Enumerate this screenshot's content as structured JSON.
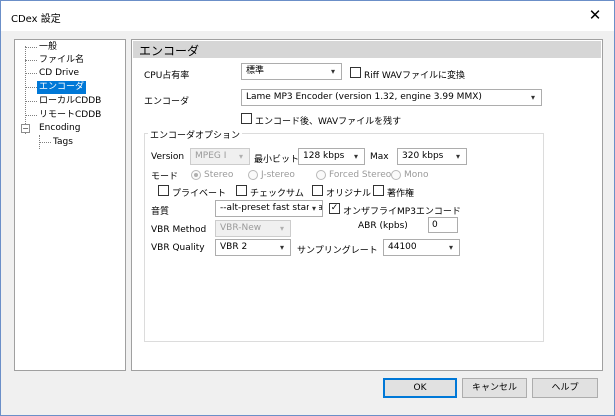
{
  "window": {
    "title": "CDex 設定",
    "close_glyph": "✕"
  },
  "tree": {
    "items": [
      {
        "label": "一般"
      },
      {
        "label": "ファイル名"
      },
      {
        "label": "CD Drive"
      },
      {
        "label": "エンコーダ",
        "selected": true
      },
      {
        "label": "ローカルCDDB"
      },
      {
        "label": "リモートCDDB"
      },
      {
        "label": "Encoding"
      },
      {
        "label": "Tags"
      }
    ],
    "expander_glyph": "−"
  },
  "panel": {
    "title": "エンコーダ",
    "cpu": {
      "label": "CPU占有率",
      "value": "標準"
    },
    "riff": {
      "label": "Riff WAVファイルに変換",
      "checked": false
    },
    "encoder": {
      "label": "エンコーダ",
      "value": "Lame MP3 Encoder (version 1.32, engine 3.99 MMX)"
    },
    "keep_wav": {
      "label": "エンコード後、WAVファイルを残す",
      "checked": false
    },
    "options": {
      "title": "エンコーダオプション",
      "version_label": "Version",
      "version_value": "MPEG I",
      "min_bitrate_label": "最小ビット",
      "min_bitrate_value": "128 kbps",
      "max_label": "Max",
      "max_value": "320 kbps",
      "mode_label": "モード",
      "mode_options": [
        "Stereo",
        "J-stereo",
        "Forced Stereo",
        "Mono"
      ],
      "flags": [
        {
          "label": "プライベート",
          "checked": false
        },
        {
          "label": "チェックサム",
          "checked": false
        },
        {
          "label": "オリジナル",
          "checked": false
        },
        {
          "label": "著作権",
          "checked": false
        }
      ],
      "quality_label": "音質",
      "quality_value": "--alt-preset fast standard",
      "on_the_fly": {
        "label": "オンザフライMP3エンコード",
        "checked": true
      },
      "vbr_method_label": "VBR Method",
      "vbr_method_value": "VBR-New",
      "abr_label": "ABR (kpbs)",
      "abr_value": "0",
      "vbr_quality_label": "VBR Quality",
      "vbr_quality_value": "VBR 2",
      "sampling_label": "サンプリングレート",
      "sampling_value": "44100"
    }
  },
  "buttons": {
    "ok": "OK",
    "cancel": "キャンセル",
    "help": "ヘルプ"
  },
  "icons": {
    "dropdown": "chevron-down-icon",
    "check": "✓"
  },
  "colors": {
    "selection": "#0078d7",
    "header": "#d6d6d6",
    "border": "#6b8fc8"
  }
}
